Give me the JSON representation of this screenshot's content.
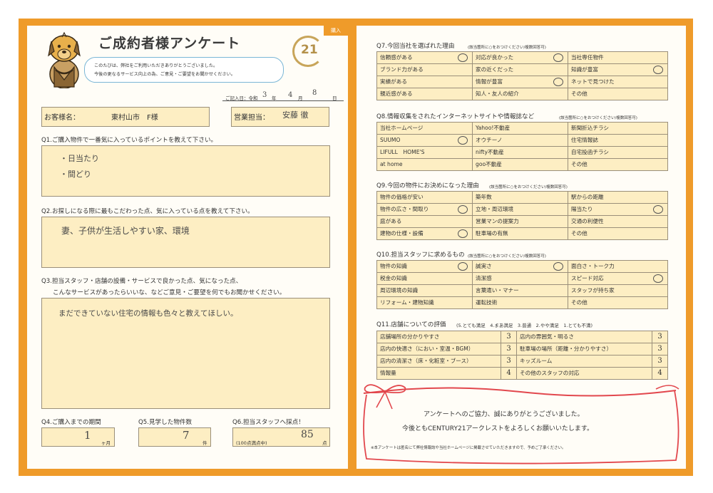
{
  "header": {
    "title": "ご成約者様アンケート",
    "tag": "購入",
    "intro": [
      "このたびは、弊社をご利用いただきありがとうございました。",
      "今後の更なるサービス向上の為、ご意見・ご要望をお聞かせください。"
    ],
    "logo_text": "21",
    "date_label": "ご記入日：令和",
    "date_year": "3",
    "date_year_unit": "年",
    "date_month": "4",
    "date_month_unit": "月",
    "date_day": "8",
    "date_day_unit": "日"
  },
  "customer": {
    "name_label": "お客様名：",
    "name_value": "東村山市　F様",
    "staff_label": "営業担当：",
    "staff_value": "安藤 徹"
  },
  "q1": {
    "label": "Q1.ご購入物件で一番気に入っているポイントを教えて下さい。",
    "answer_lines": [
      "・日当たり",
      "・間どり"
    ]
  },
  "q2": {
    "label": "Q2.お探しになる際に最もこだわった点、気に入っている点を教えて下さい。",
    "answer": "妻、子供が生活しやすい家、環境"
  },
  "q3": {
    "label_lines": [
      "Q3.担当スタッフ・店舗の設備・サービスで良かった点、気になった点、",
      "こんなサービスがあったらいいな、などご意見・ご要望を何でもお聞かせください。"
    ],
    "answer": "まだできていない住宅の情報も色々と教えてほしい。"
  },
  "q4": {
    "label": "Q4.ご購入までの期間",
    "value": "1",
    "unit": "ヶ月"
  },
  "q5": {
    "label": "Q5.見学した物件数",
    "value": "7",
    "unit": "件"
  },
  "q6": {
    "label": "Q6.担当スタッフへ採点！",
    "note": "(100点満点中)",
    "value": "85",
    "unit": "点"
  },
  "q7": {
    "title": "Q7.今回当社を選ばれた理由",
    "note": "(該当箇所に○をおつけください/複数回答可)",
    "rows": [
      [
        {
          "text": "信頼感がある",
          "circle": true
        },
        {
          "text": "対応が良かった",
          "circle": true
        },
        {
          "text": "当社専任物件",
          "circle": false
        }
      ],
      [
        {
          "text": "ブランド力がある",
          "circle": false
        },
        {
          "text": "家の近くだった",
          "circle": false
        },
        {
          "text": "知識が豊富",
          "circle": true
        }
      ],
      [
        {
          "text": "実績がある",
          "circle": false
        },
        {
          "text": "情報が豊富",
          "circle": true
        },
        {
          "text": "ネットで見つけた",
          "circle": false
        }
      ],
      [
        {
          "text": "親近感がある",
          "circle": false
        },
        {
          "text": "知人・友人の紹介",
          "circle": false
        },
        {
          "text": "その他",
          "circle": false
        }
      ]
    ]
  },
  "q8": {
    "title": "Q8.情報収集をされたインターネットサイトや情報誌など",
    "note": "(該当箇所に○をおつけください/複数回答可)",
    "rows": [
      [
        {
          "text": "当社ホームページ",
          "circle": false
        },
        {
          "text": "Yahoo!不動産",
          "circle": false
        },
        {
          "text": "新聞折込チラシ",
          "circle": false
        }
      ],
      [
        {
          "text": "SUUMO",
          "circle": true
        },
        {
          "text": "オウチーノ",
          "circle": false
        },
        {
          "text": "住宅情報誌",
          "circle": false
        }
      ],
      [
        {
          "text": "LIFULL　HOME'S",
          "circle": false
        },
        {
          "text": "nifty不動産",
          "circle": false
        },
        {
          "text": "自宅投函チラシ",
          "circle": false
        }
      ],
      [
        {
          "text": "at home",
          "circle": false
        },
        {
          "text": "goo不動産",
          "circle": false
        },
        {
          "text": "その他",
          "circle": false
        }
      ]
    ]
  },
  "q9": {
    "title": "Q9.今回の物件にお決めになった理由",
    "note": "(該当箇所に○をおつけください/複数回答可)",
    "rows": [
      [
        {
          "text": "物件の価格が安い",
          "circle": false
        },
        {
          "text": "築年数",
          "circle": false
        },
        {
          "text": "駅からの距離",
          "circle": false
        }
      ],
      [
        {
          "text": "物件の広さ・間取り",
          "circle": true
        },
        {
          "text": "立地・周辺環境",
          "circle": false
        },
        {
          "text": "陽当たり",
          "circle": true
        }
      ],
      [
        {
          "text": "庭がある",
          "circle": false
        },
        {
          "text": "営業マンの提案力",
          "circle": false
        },
        {
          "text": "交通の利便性",
          "circle": false
        }
      ],
      [
        {
          "text": "建物の仕様・設備",
          "circle": true
        },
        {
          "text": "駐車場の有無",
          "circle": false
        },
        {
          "text": "その他",
          "circle": false
        }
      ]
    ]
  },
  "q10": {
    "title": "Q10.担当スタッフに求めるもの",
    "note": "(該当箇所に○をおつけください/複数回答可)",
    "rows": [
      [
        {
          "text": "物件の知識",
          "circle": true
        },
        {
          "text": "誠実さ",
          "circle": true
        },
        {
          "text": "面白さ・トーク力",
          "circle": false
        }
      ],
      [
        {
          "text": "税金の知識",
          "circle": false
        },
        {
          "text": "清潔感",
          "circle": false
        },
        {
          "text": "スピード対応",
          "circle": true
        }
      ],
      [
        {
          "text": "周辺環境の知識",
          "circle": false
        },
        {
          "text": "言葉遣い・マナー",
          "circle": false
        },
        {
          "text": "スタッフが持ち家",
          "circle": false
        }
      ],
      [
        {
          "text": "リフォーム・建物知識",
          "circle": false
        },
        {
          "text": "運転技術",
          "circle": false
        },
        {
          "text": "その他",
          "circle": false
        }
      ]
    ]
  },
  "q11": {
    "title": "Q11.店舗についての評価",
    "scale": "(5.とても満足　4.まあ満足　3.普通　2.やや満足　1.とても不満)",
    "rows": [
      {
        "left": "店舗場所の分かりやすさ",
        "left_score": "3",
        "right": "店内の雰囲気・明るさ",
        "right_score": "3"
      },
      {
        "left": "店内の快適さ（におい・室温・BGM）",
        "left_score": "3",
        "right": "駐車場の場所（距離・分かりやすさ）",
        "right_score": "3"
      },
      {
        "left": "店内の清潔さ（床・化粧室・ブース）",
        "left_score": "3",
        "right": "キッズルーム",
        "right_score": "3"
      },
      {
        "left": "情報量",
        "left_score": "4",
        "right": "その他のスタッフの対応",
        "right_score": "4"
      }
    ]
  },
  "thanks": {
    "line1": "アンケートへのご協力、誠にありがとうございました。",
    "line2": "今後ともCENTURY21アークレストをよろしくお願いいたします。",
    "footnote": "※本アンケートは匿名にて弊社情報誌や当社ホームページに掲載させていただきますので、予めご了承ください。"
  },
  "colors": {
    "frame": "#ef9b2a",
    "fill": "#fdeec3",
    "ribbon": "#e2474d",
    "logo_gold": "#c8a55a"
  }
}
